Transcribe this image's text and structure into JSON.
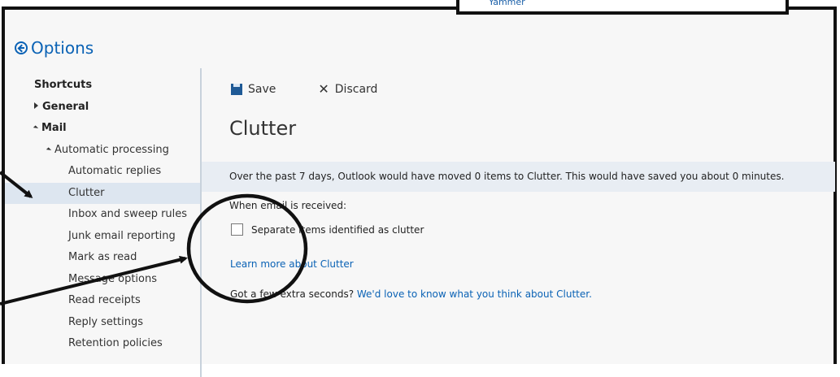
{
  "popup": {
    "text": "Yammer"
  },
  "header": {
    "title": "Options"
  },
  "sidebar": {
    "items": [
      {
        "label": "Shortcuts"
      },
      {
        "label": "General"
      },
      {
        "label": "Mail"
      },
      {
        "label": "Automatic processing"
      },
      {
        "label": "Automatic replies"
      },
      {
        "label": "Clutter"
      },
      {
        "label": "Inbox and sweep rules"
      },
      {
        "label": "Junk email reporting"
      },
      {
        "label": "Mark as read"
      },
      {
        "label": "Message options"
      },
      {
        "label": "Read receipts"
      },
      {
        "label": "Reply settings"
      },
      {
        "label": "Retention policies"
      }
    ]
  },
  "toolbar": {
    "save_label": "Save",
    "discard_label": "Discard"
  },
  "main": {
    "heading": "Clutter",
    "info": "Over the past 7 days, Outlook would have moved 0 items to Clutter. This would have saved you about 0 minutes.",
    "when_label": "When email is received:",
    "checkbox_label": "Separate items identified as clutter",
    "learn_more": "Learn more about Clutter",
    "feedback_prefix": "Got a few extra seconds?",
    "feedback_link": "We'd love to know what you think about Clutter."
  },
  "colors": {
    "accent": "#0a62b5",
    "selected_bg": "#dde6f0",
    "info_bg": "#e8edf3"
  }
}
